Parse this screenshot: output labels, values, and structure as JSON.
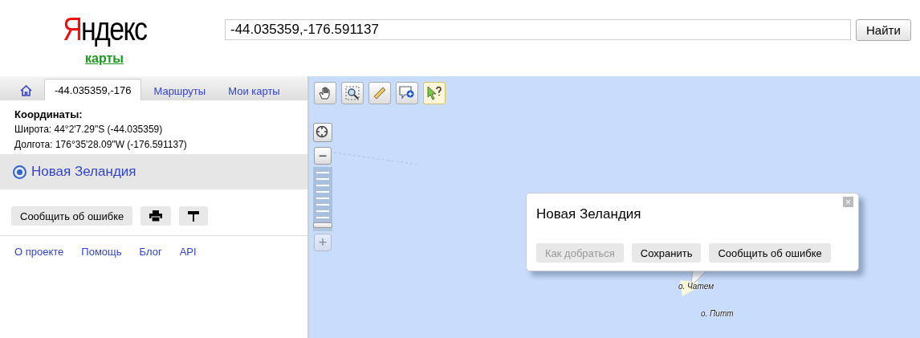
{
  "logo": {
    "brand_first": "Я",
    "brand_rest": "ндекс",
    "service": "карты"
  },
  "search": {
    "value": "-44.035359,-176.591137",
    "button": "Найти"
  },
  "tabs": [
    {
      "kind": "home",
      "selected": false
    },
    {
      "kind": "text",
      "label": "-44.035359,-176",
      "selected": true
    },
    {
      "kind": "text",
      "label": "Маршруты",
      "selected": false
    },
    {
      "kind": "text",
      "label": "Мои карты",
      "selected": false
    }
  ],
  "coordinates": {
    "title": "Координаты:",
    "lines": [
      "Широта: 44°2'7.29\"S (-44.035359)",
      "Долгота: 176°35'28.09\"W (-176.591137)"
    ]
  },
  "result": {
    "label": "Новая Зеландия",
    "selected": true
  },
  "actions": [
    {
      "kind": "text",
      "label": "Сообщить об ошибке"
    },
    {
      "kind": "print"
    },
    {
      "kind": "pin"
    }
  ],
  "footer_links": [
    "О проекте",
    "Помощь",
    "Блог",
    "API"
  ],
  "map": {
    "tools": [
      {
        "kind": "hand",
        "selected": false
      },
      {
        "kind": "zoom",
        "selected": false
      },
      {
        "kind": "ruler",
        "selected": false
      },
      {
        "kind": "placemark",
        "selected": false
      },
      {
        "kind": "info",
        "selected": true
      }
    ],
    "zoom": {
      "minus": "−",
      "plus": "+",
      "level": 0.95
    },
    "balloon": {
      "title": "Новая Зеландия",
      "close": "×",
      "buttons": [
        {
          "label": "Как добраться",
          "disabled": true
        },
        {
          "label": "Сохранить",
          "disabled": false
        },
        {
          "label": "Сообщить об ошибке",
          "disabled": false
        }
      ]
    },
    "labels": [
      "о. Чатем",
      "о. Питт"
    ]
  }
}
